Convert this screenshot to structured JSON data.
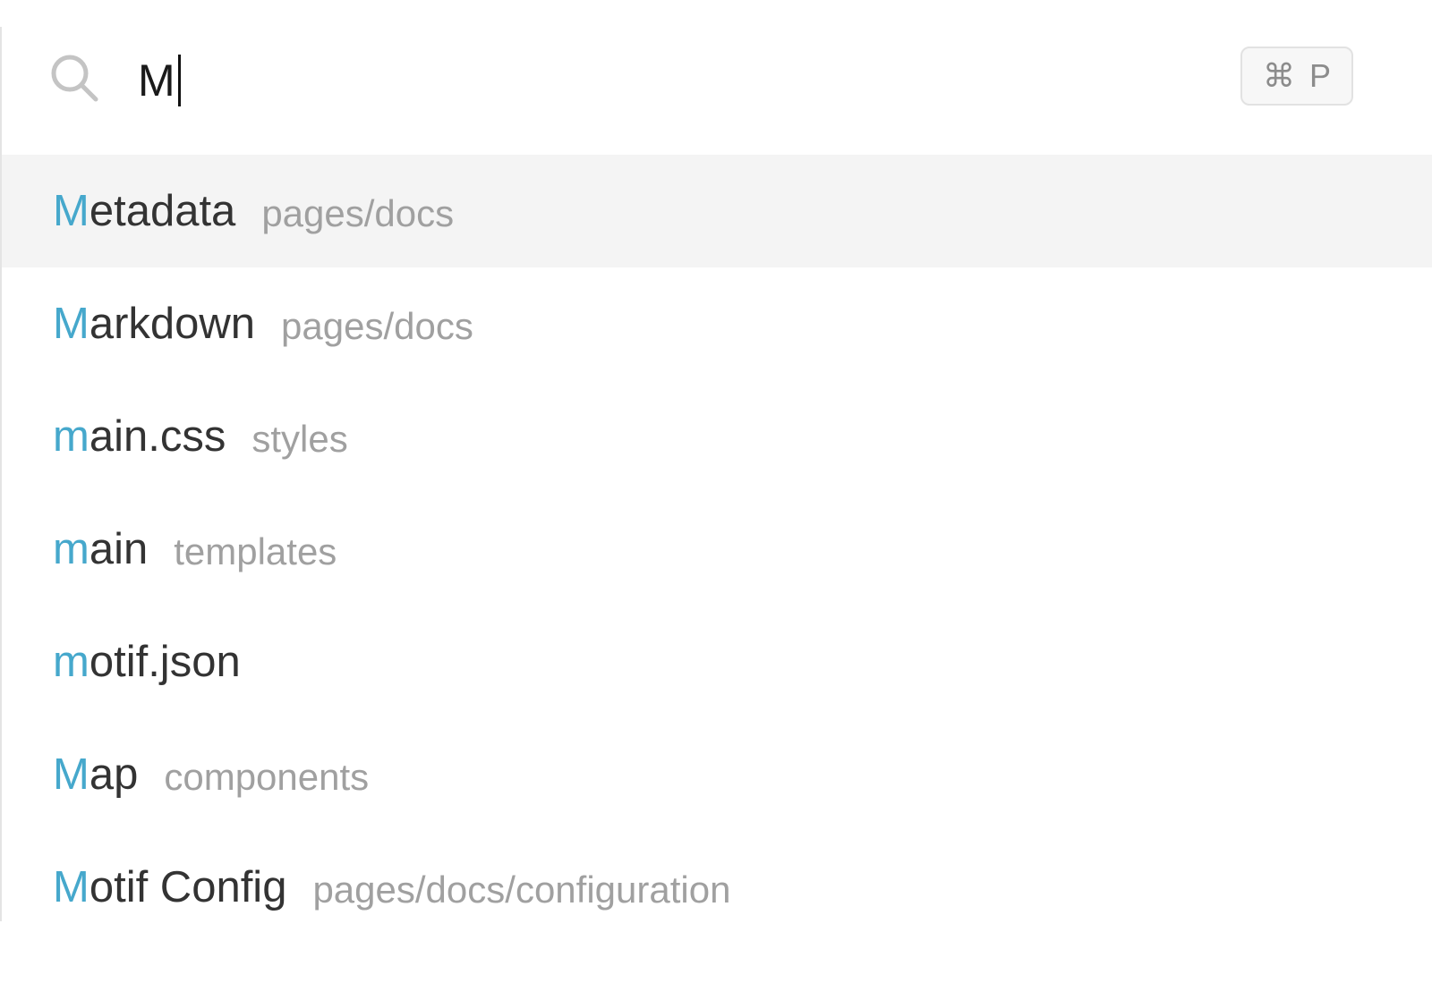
{
  "search": {
    "query": "M",
    "icon": "search-icon",
    "shortcut": {
      "symbol": "⌘",
      "key": "P"
    }
  },
  "colors": {
    "match_highlight": "#46a8cc",
    "selected_row": "#f4f4f4",
    "path_text": "#a0a0a0",
    "name_text": "#333333"
  },
  "results": [
    {
      "match": "M",
      "rest": "etadata",
      "path": "pages/docs",
      "selected": true
    },
    {
      "match": "M",
      "rest": "arkdown",
      "path": "pages/docs",
      "selected": false
    },
    {
      "match": "m",
      "rest": "ain.css",
      "path": "styles",
      "selected": false
    },
    {
      "match": "m",
      "rest": "ain",
      "path": "templates",
      "selected": false
    },
    {
      "match": "m",
      "rest": "otif.json",
      "path": "",
      "selected": false
    },
    {
      "match": "M",
      "rest": "ap",
      "path": "components",
      "selected": false
    },
    {
      "match": "M",
      "rest": "otif Config",
      "path": "pages/docs/configuration",
      "selected": false
    }
  ]
}
